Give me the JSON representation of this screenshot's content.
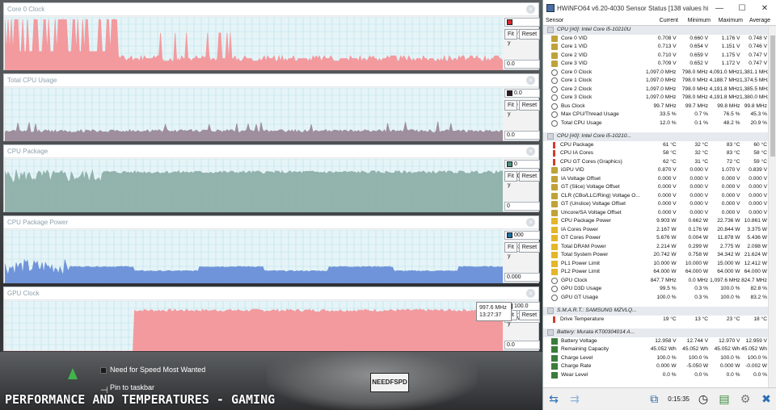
{
  "colors": {
    "core_clock": "#f4969a",
    "cpu_usage": "#9c8a99",
    "cpu_package": "#8fb0aa",
    "package_power": "#6a8fd8",
    "gpu_clock": "#f4969a",
    "grid": "#b8e1ea",
    "plot_bg": "#e6f4f7"
  },
  "graphs": [
    {
      "title": "Core 0 Clock",
      "value": "1,097.0 MHz",
      "min": "0.0",
      "swatch": "#d8262d",
      "top_label": "",
      "fit": "Fit y",
      "reset": "Reset"
    },
    {
      "title": "Total CPU Usage",
      "value": "12.0 %",
      "min": "0.0",
      "swatch": "#2b1a28",
      "top_label": "0.0",
      "fit": "Fit y",
      "reset": "Reset"
    },
    {
      "title": "CPU Package",
      "value": "61 °C",
      "min": "0",
      "swatch": "#4a8f82",
      "top_label": "0",
      "fit": "Fit y",
      "reset": "Reset"
    },
    {
      "title": "CPU Package Power",
      "value": "9.903 W",
      "min": "0.000",
      "swatch": "#1a6da3",
      "top_label": "000",
      "fit": "Fit y",
      "reset": "Reset"
    },
    {
      "title": "GPU Clock",
      "value": "7.7 MHz",
      "min": "0.0",
      "swatch": "#d8262d",
      "top_label": "100.0",
      "fit": "Fit y",
      "reset": "Reset"
    }
  ],
  "tooltip": {
    "line1": "997.6 MHz",
    "line2": "13:27:37"
  },
  "taskbar": {
    "item1": "Need for Speed Most Wanted",
    "item2": "Pin to taskbar"
  },
  "overlay_title": "PERFORMANCE AND TEMPERATURES - GAMING",
  "plate_text": "NEEDFSPD",
  "hwinfo": {
    "title": "HWiNFO64 v6.20-4030 Sensor Status [138 values hid...",
    "headers": {
      "sensor": "Sensor",
      "current": "Current",
      "minimum": "Minimum",
      "maximum": "Maximum",
      "average": "Average"
    },
    "timer": "0:15:35",
    "rows": [
      {
        "g": "CPU [#0]: Intel Core i5-10210U"
      },
      {
        "i": "volt",
        "n": "Core 0 VID",
        "c": "0.708 V",
        "mi": "0.660 V",
        "ma": "1.176 V",
        "a": "0.748 V"
      },
      {
        "i": "volt",
        "n": "Core 1 VID",
        "c": "0.713 V",
        "mi": "0.654 V",
        "ma": "1.151 V",
        "a": "0.746 V"
      },
      {
        "i": "volt",
        "n": "Core 2 VID",
        "c": "0.710 V",
        "mi": "0.659 V",
        "ma": "1.175 V",
        "a": "0.747 V"
      },
      {
        "i": "volt",
        "n": "Core 3 VID",
        "c": "0.709 V",
        "mi": "0.652 V",
        "ma": "1.172 V",
        "a": "0.747 V"
      },
      {
        "i": "clock",
        "n": "Core 0 Clock",
        "c": "1,097.0 MHz",
        "mi": "798.0 MHz",
        "ma": "4,091.0 MHz",
        "a": "1,381.1 MHz"
      },
      {
        "i": "clock",
        "n": "Core 1 Clock",
        "c": "1,097.0 MHz",
        "mi": "798.0 MHz",
        "ma": "4,188.7 MHz",
        "a": "1,374.5 MHz"
      },
      {
        "i": "clock",
        "n": "Core 2 Clock",
        "c": "1,097.0 MHz",
        "mi": "798.0 MHz",
        "ma": "4,191.8 MHz",
        "a": "1,385.5 MHz"
      },
      {
        "i": "clock",
        "n": "Core 3 Clock",
        "c": "1,097.0 MHz",
        "mi": "798.0 MHz",
        "ma": "4,191.8 MHz",
        "a": "1,380.0 MHz"
      },
      {
        "i": "clock",
        "n": "Bus Clock",
        "c": "99.7 MHz",
        "mi": "99.7 MHz",
        "ma": "99.8 MHz",
        "a": "99.8 MHz"
      },
      {
        "i": "clock",
        "n": "Max CPU/Thread Usage",
        "c": "33.5 %",
        "mi": "0.7 %",
        "ma": "76.5 %",
        "a": "45.3 %"
      },
      {
        "i": "clock",
        "n": "Total CPU Usage",
        "c": "12.0 %",
        "mi": "0.1 %",
        "ma": "48.2 %",
        "a": "20.9 %"
      },
      {
        "s": true
      },
      {
        "g": "CPU [#0]: Intel Core i5-10210..."
      },
      {
        "i": "temp",
        "n": "CPU Package",
        "c": "61 °C",
        "mi": "32 °C",
        "ma": "83 °C",
        "a": "60 °C"
      },
      {
        "i": "temp",
        "n": "CPU IA Cores",
        "c": "58 °C",
        "mi": "32 °C",
        "ma": "83 °C",
        "a": "58 °C"
      },
      {
        "i": "temp",
        "n": "CPU GT Cores (Graphics)",
        "c": "62 °C",
        "mi": "31 °C",
        "ma": "72 °C",
        "a": "59 °C"
      },
      {
        "i": "volt",
        "n": "iGPU VID",
        "c": "0.870 V",
        "mi": "0.000 V",
        "ma": "1.070 V",
        "a": "0.839 V"
      },
      {
        "i": "volt",
        "n": "IA Voltage Offset",
        "c": "0.000 V",
        "mi": "0.000 V",
        "ma": "0.000 V",
        "a": "0.000 V"
      },
      {
        "i": "volt",
        "n": "GT (Slice) Voltage Offset",
        "c": "0.000 V",
        "mi": "0.000 V",
        "ma": "0.000 V",
        "a": "0.000 V"
      },
      {
        "i": "volt",
        "n": "CLR (CBo/LLC/Ring) Voltage O...",
        "c": "0.000 V",
        "mi": "0.000 V",
        "ma": "0.000 V",
        "a": "0.000 V"
      },
      {
        "i": "volt",
        "n": "GT (Unslice) Voltage Offset",
        "c": "0.000 V",
        "mi": "0.000 V",
        "ma": "0.000 V",
        "a": "0.000 V"
      },
      {
        "i": "volt",
        "n": "Uncore/SA Voltage Offset",
        "c": "0.000 V",
        "mi": "0.000 V",
        "ma": "0.000 V",
        "a": "0.000 V"
      },
      {
        "i": "power",
        "n": "CPU Package Power",
        "c": "9.903 W",
        "mi": "0.662 W",
        "ma": "22.736 W",
        "a": "10.861 W"
      },
      {
        "i": "power",
        "n": "IA Cores Power",
        "c": "2.167 W",
        "mi": "0.176 W",
        "ma": "20.844 W",
        "a": "3.375 W"
      },
      {
        "i": "power",
        "n": "GT Cores Power",
        "c": "5.676 W",
        "mi": "0.004 W",
        "ma": "11.878 W",
        "a": "5.436 W"
      },
      {
        "i": "power",
        "n": "Total DRAM Power",
        "c": "2.214 W",
        "mi": "0.299 W",
        "ma": "2.775 W",
        "a": "2.098 W"
      },
      {
        "i": "power",
        "n": "Total System Power",
        "c": "20.742 W",
        "mi": "0.758 W",
        "ma": "34.342 W",
        "a": "21.624 W"
      },
      {
        "i": "power",
        "n": "PL1 Power Limit",
        "c": "10.000 W",
        "mi": "10.000 W",
        "ma": "15.000 W",
        "a": "12.412 W"
      },
      {
        "i": "power",
        "n": "PL2 Power Limit",
        "c": "64.000 W",
        "mi": "64.000 W",
        "ma": "64.000 W",
        "a": "64.000 W"
      },
      {
        "i": "clock",
        "n": "GPU Clock",
        "c": "847.7 MHz",
        "mi": "0.0 MHz",
        "ma": "1,097.6 MHz",
        "a": "824.7 MHz"
      },
      {
        "i": "clock",
        "n": "GPU D3D Usage",
        "c": "99.5 %",
        "mi": "0.3 %",
        "ma": "100.0 %",
        "a": "82.8 %"
      },
      {
        "i": "clock",
        "n": "GPU GT Usage",
        "c": "100.0 %",
        "mi": "0.3 %",
        "ma": "100.0 %",
        "a": "83.2 %"
      },
      {
        "s": true
      },
      {
        "g": "S.M.A.R.T.: SAMSUNG MZVLQ..."
      },
      {
        "i": "temp",
        "n": "Drive Temperature",
        "c": "19 °C",
        "mi": "13 °C",
        "ma": "23 °C",
        "a": "18 °C"
      },
      {
        "s": true
      },
      {
        "g": "Battery: Murata KT00304014 A..."
      },
      {
        "i": "bat",
        "n": "Battery Voltage",
        "c": "12.958 V",
        "mi": "12.744 V",
        "ma": "12.970 V",
        "a": "12.959 V"
      },
      {
        "i": "bat",
        "n": "Remaining Capacity",
        "c": "45.052 Wh",
        "mi": "45.052 Wh",
        "ma": "45.052 Wh",
        "a": "45.052 Wh"
      },
      {
        "i": "bat",
        "n": "Charge Level",
        "c": "100.0 %",
        "mi": "100.0 %",
        "ma": "100.0 %",
        "a": "100.0 %"
      },
      {
        "i": "bat",
        "n": "Charge Rate",
        "c": "0.000 W",
        "mi": "-5.050 W",
        "ma": "0.000 W",
        "a": "-0.002 W"
      },
      {
        "i": "bat",
        "n": "Wear Level",
        "c": "0.0 %",
        "mi": "0.0 %",
        "ma": "0.0 %",
        "a": "0.0 %"
      }
    ]
  }
}
